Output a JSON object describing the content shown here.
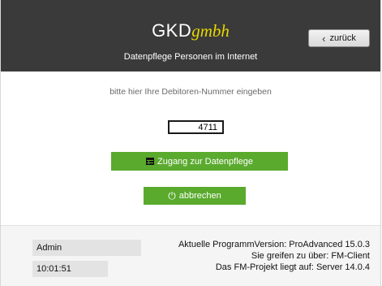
{
  "header": {
    "brand": "GKD",
    "brand_suffix": "gmbh",
    "subtitle": "Datenpflege Personen im Internet",
    "back_button_label": "zurück",
    "back_icon": "chevron-left-icon"
  },
  "main": {
    "prompt": "bitte hier Ihre Debitoren-Nummer eingeben",
    "debitor_number": "4711",
    "access_button_label": "Zugang zur Datenpflege",
    "access_icon": "table-icon",
    "cancel_button_label": "abbrechen",
    "cancel_icon": "power-icon",
    "accent_color": "#5aaa2e"
  },
  "footer": {
    "user": "Admin",
    "time": "10:01:51",
    "version_line": "Aktuelle ProgrammVersion: ProAdvanced 15.0.3",
    "access_line": "Sie greifen zu über: FM-Client",
    "server_line": "Das FM-Projekt liegt auf: Server 14.0.4"
  }
}
